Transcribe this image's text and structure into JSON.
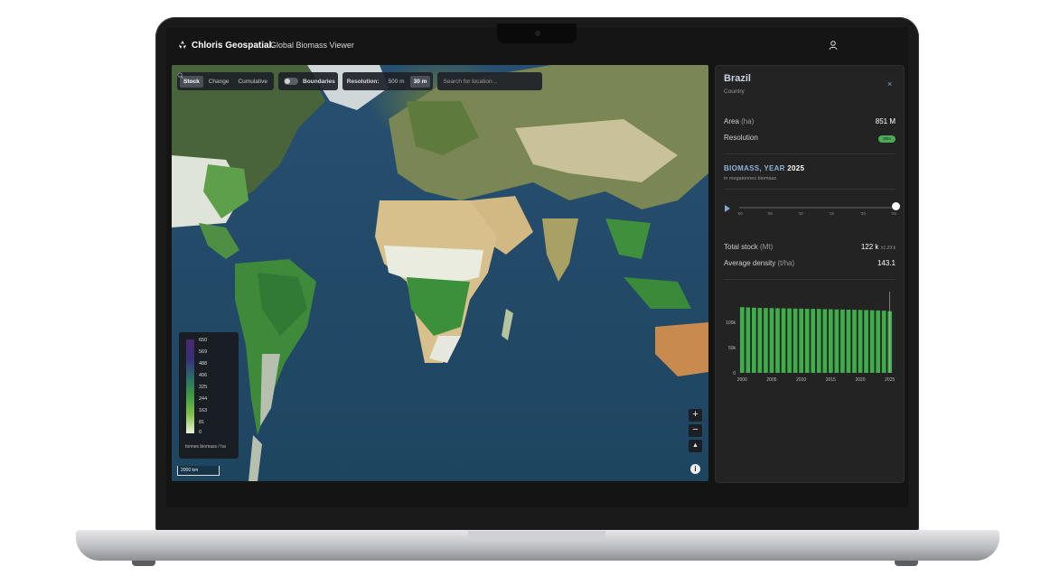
{
  "app": {
    "brand": "Chloris Geospatial.",
    "title": "Global Biomass Viewer"
  },
  "toolbar": {
    "modes": [
      {
        "label": "Stock",
        "active": true
      },
      {
        "label": "Change",
        "active": false
      },
      {
        "label": "Cumulative",
        "active": false
      }
    ],
    "boundaries_label": "Boundaries",
    "boundaries_on": false,
    "resolution_label": "Resolution:",
    "resolutions": [
      {
        "label": "500 m",
        "active": false
      },
      {
        "label": "30 m",
        "active": true
      }
    ],
    "search_placeholder": "Search for location..."
  },
  "legend": {
    "ticks": [
      "650",
      "569",
      "488",
      "406",
      "325",
      "244",
      "163",
      "81",
      "0"
    ],
    "unit": "tonnes biomass / ha",
    "colors": [
      "#4b2a6e",
      "#3f9a43",
      "#eef2d8"
    ]
  },
  "map": {
    "scale_label": "2000 km",
    "zoom_in": "+",
    "zoom_out": "−",
    "compass": "▲",
    "info": "i"
  },
  "panel": {
    "title": "Brazil",
    "subtitle": "Country",
    "close": "×",
    "area_label": "Area",
    "area_unit": "(ha)",
    "area_value": "851 M",
    "resolution_label": "Resolution",
    "resolution_badge": "30m",
    "section_title": "BIOMASS, YEAR",
    "section_year": "2025",
    "section_sub": "in megatonnes biomass",
    "timeline_ticks": [
      "'00",
      "'05",
      "'10",
      "'15",
      "'20",
      "'25"
    ],
    "timeline_value": 2025,
    "total_stock_label": "Total stock",
    "total_stock_unit": "(Mt)",
    "total_stock_value": "122 k",
    "total_stock_sd": "±1.23 k",
    "avg_density_label": "Average density",
    "avg_density_unit": "(t/ha)",
    "avg_density_value": "143.1"
  },
  "chart_data": {
    "type": "bar",
    "categories": [
      "2000",
      "2001",
      "2002",
      "2003",
      "2004",
      "2005",
      "2006",
      "2007",
      "2008",
      "2009",
      "2010",
      "2011",
      "2012",
      "2013",
      "2014",
      "2015",
      "2016",
      "2017",
      "2018",
      "2019",
      "2020",
      "2021",
      "2022",
      "2023",
      "2024",
      "2025"
    ],
    "values": [
      130000,
      129500,
      129000,
      128500,
      128300,
      128000,
      127800,
      127600,
      127400,
      127200,
      127000,
      126800,
      126500,
      126300,
      126000,
      125800,
      125500,
      125300,
      125000,
      124800,
      124500,
      124200,
      123800,
      123400,
      123000,
      122000
    ],
    "ylim": [
      0,
      150000
    ],
    "y_ticks": [
      "0",
      "50k",
      "100k"
    ],
    "y_tick_values": [
      0,
      50000,
      100000
    ],
    "x_ticks": [
      "2000",
      "2005",
      "2010",
      "2015",
      "2020",
      "2025"
    ],
    "color": "#3fae4a",
    "grid": false
  }
}
